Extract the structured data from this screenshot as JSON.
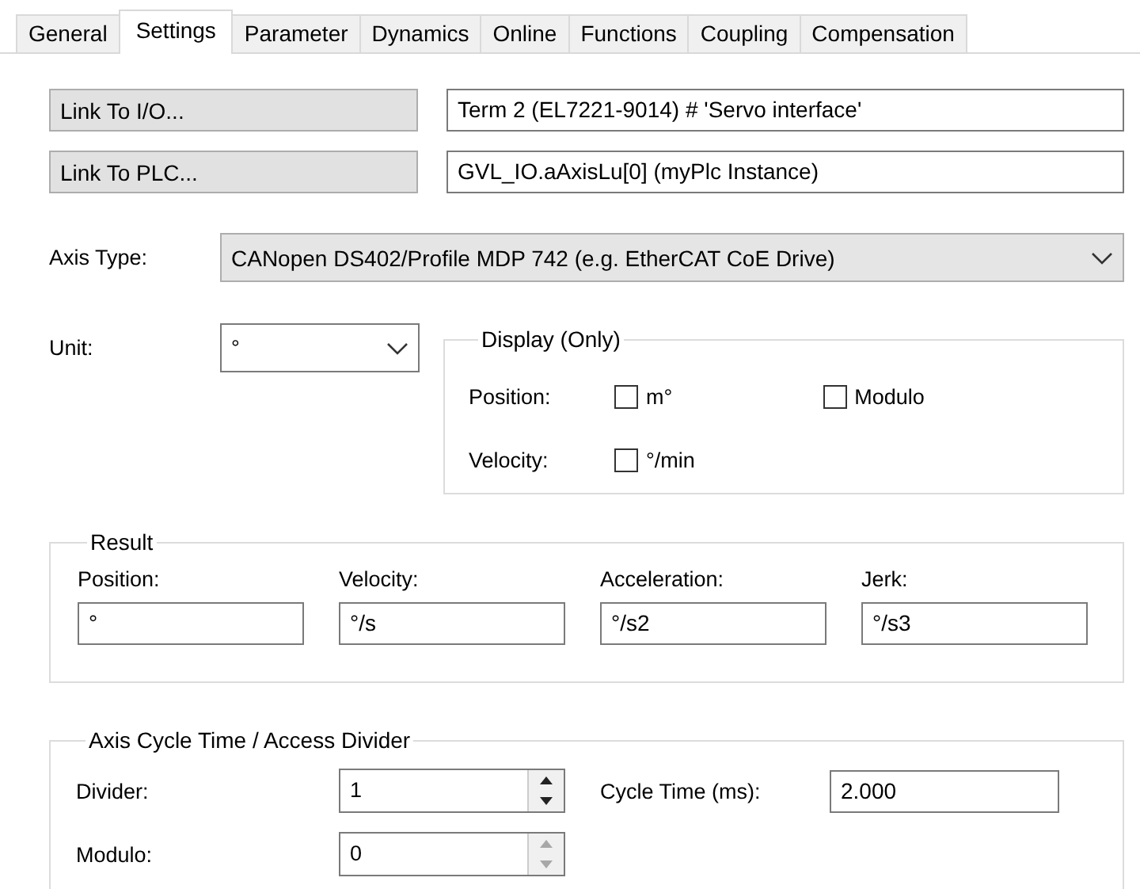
{
  "tabs": [
    {
      "label": "General",
      "selected": false
    },
    {
      "label": "Settings",
      "selected": true
    },
    {
      "label": "Parameter",
      "selected": false
    },
    {
      "label": "Dynamics",
      "selected": false
    },
    {
      "label": "Online",
      "selected": false
    },
    {
      "label": "Functions",
      "selected": false
    },
    {
      "label": "Coupling",
      "selected": false
    },
    {
      "label": "Compensation",
      "selected": false
    }
  ],
  "links": [
    {
      "button": "Link To I/O...",
      "value": "Term 2 (EL7221-9014) # 'Servo interface'"
    },
    {
      "button": "Link To PLC...",
      "value": "GVL_IO.aAxisLu[0] (myPlc Instance)"
    }
  ],
  "axis_type": {
    "label": "Axis Type:",
    "value": "CANopen DS402/Profile MDP 742 (e.g. EtherCAT CoE Drive)"
  },
  "unit": {
    "label": "Unit:",
    "value": "°"
  },
  "display": {
    "title": "Display (Only)",
    "rows": [
      {
        "label": "Position:",
        "options": [
          {
            "label": "m°",
            "checked": false
          },
          {
            "label": "Modulo",
            "checked": false
          }
        ]
      },
      {
        "label": "Velocity:",
        "options": [
          {
            "label": "°/min",
            "checked": false
          }
        ]
      }
    ]
  },
  "result": {
    "title": "Result",
    "fields": [
      {
        "label": "Position:",
        "value": "°"
      },
      {
        "label": "Velocity:",
        "value": "°/s"
      },
      {
        "label": "Acceleration:",
        "value": "°/s2"
      },
      {
        "label": "Jerk:",
        "value": "°/s3"
      }
    ]
  },
  "cycle": {
    "title": "Axis Cycle Time / Access Divider",
    "divider": {
      "label": "Divider:",
      "value": "1",
      "disabled": false
    },
    "cycle_time": {
      "label": "Cycle Time (ms):",
      "value": "2.000"
    },
    "modulo": {
      "label": "Modulo:",
      "value": "0",
      "disabled": true
    }
  }
}
